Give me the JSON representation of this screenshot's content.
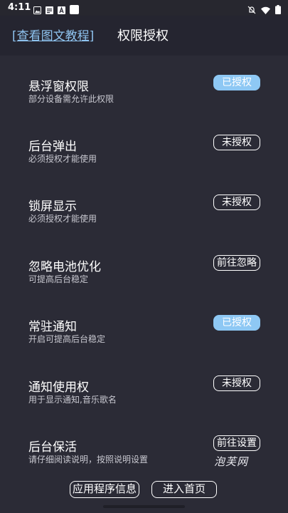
{
  "status_bar": {
    "time": "4:11",
    "left_icons": [
      "image-icon",
      "text-icon",
      "a-icon",
      "square-icon"
    ],
    "right_icons": [
      "mute-icon",
      "wifi-icon",
      "battery-icon"
    ]
  },
  "header": {
    "tutorial_link": "[查看图文教程]",
    "title": "权限授权"
  },
  "permissions": [
    {
      "title": "悬浮窗权限",
      "desc": "部分设备需允许此权限",
      "button": "已授权",
      "state": "granted"
    },
    {
      "title": "后台弹出",
      "desc": "必须授权才能使用",
      "button": "未授权",
      "state": "not_granted"
    },
    {
      "title": "锁屏显示",
      "desc": "必须授权才能使用",
      "button": "未授权",
      "state": "not_granted"
    },
    {
      "title": "忽略电池优化",
      "desc": "可提高后台稳定",
      "button": "前往忽略",
      "state": "action"
    },
    {
      "title": "常驻通知",
      "desc": "开启可提高后台稳定",
      "button": "已授权",
      "state": "granted"
    },
    {
      "title": "通知使用权",
      "desc": "用于显示通知,音乐歌名",
      "button": "未授权",
      "state": "not_granted"
    },
    {
      "title": "后台保活",
      "desc": "请仔细阅读说明，按照说明设置",
      "button": "前往设置",
      "state": "action"
    }
  ],
  "watermark": "泡芙网",
  "footer": {
    "app_info": "应用程序信息",
    "enter_home": "进入首页"
  },
  "colors": {
    "background": "#2b2b36",
    "granted_button": "#8ec8f4",
    "link": "#8fc4f0"
  }
}
